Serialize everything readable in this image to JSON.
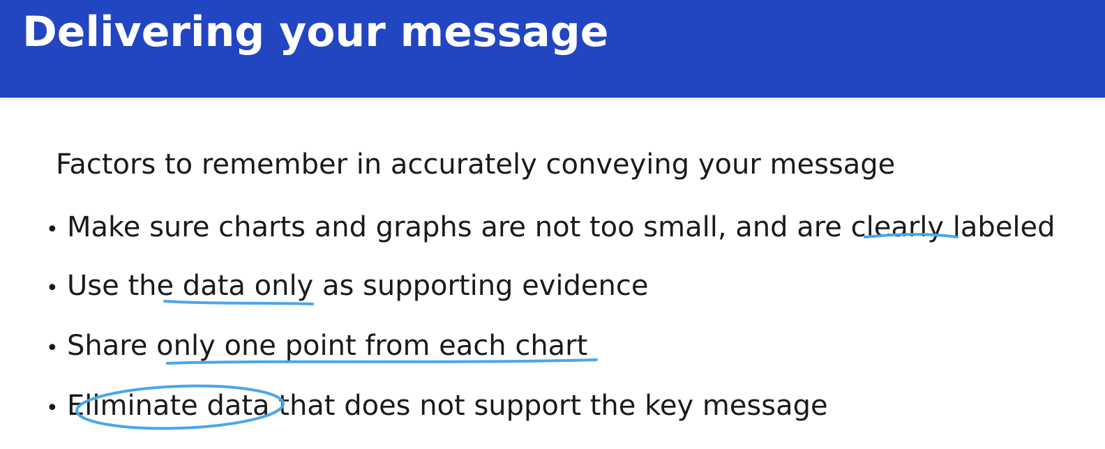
{
  "slide": {
    "title": "Delivering your message",
    "subtitle": "Factors to remember in accurately conveying your message",
    "bullet_symbol": "•",
    "bullets": [
      "Make sure charts and graphs are not too small, and are clearly labeled",
      "Use the data only as supporting evidence",
      "Share only one point from each chart",
      "Eliminate data that does not support the key message"
    ]
  },
  "colors": {
    "header_background": "#2245c2",
    "header_text": "#ffffff",
    "body_text": "#1a1a1a",
    "annotation_ink": "#4aa6ea"
  }
}
